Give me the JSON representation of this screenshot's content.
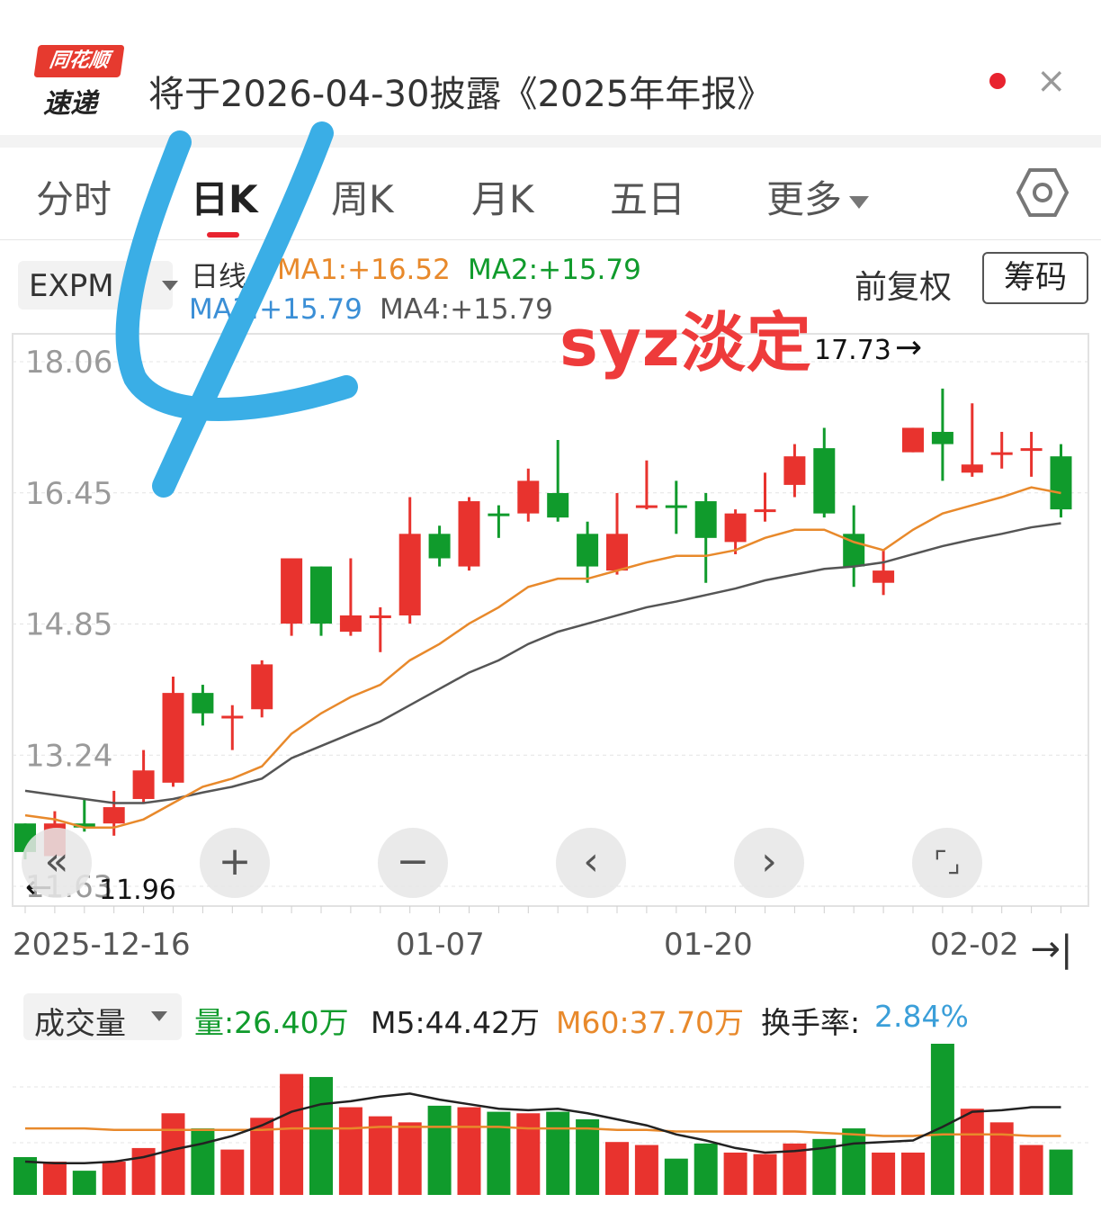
{
  "banner": {
    "logo_top": "同花顺",
    "logo_bottom": "速递",
    "title": "将于2026-04-30披露《2025年年报》",
    "close_glyph": "×"
  },
  "tabs": [
    {
      "label": "分时"
    },
    {
      "label": "日K"
    },
    {
      "label": "周K"
    },
    {
      "label": "月K"
    },
    {
      "label": "五日"
    },
    {
      "label": "更多"
    }
  ],
  "indicator": {
    "selected": "EXPM",
    "line_label": "日线",
    "ma1": "MA1:+16.52",
    "ma2": "MA2:+15.79",
    "ma3": "MA3:+15.79",
    "ma4": "MA4:+15.79",
    "fuquan": "前复权",
    "chouma": "筹码"
  },
  "colors": {
    "up": "#e8332e",
    "down": "#109b2c",
    "ma1": "#e8892b",
    "ma2": "#555555",
    "ma3": "#3b8fd6",
    "turnover": "#3b9fd9",
    "watermark": "#ee3b3b",
    "scribble": "#3aaee6"
  },
  "annotations": {
    "high_label": "17.73",
    "high_arrow": "→",
    "low_label": "11.96",
    "low_arrow": "←",
    "watermark": "syz淡定"
  },
  "controls": [
    {
      "name": "rewind-button",
      "glyph": "«"
    },
    {
      "name": "zoom-in-button",
      "glyph": "+"
    },
    {
      "name": "zoom-out-button",
      "glyph": "−"
    },
    {
      "name": "prev-button",
      "glyph": "‹"
    },
    {
      "name": "next-button",
      "glyph": "›"
    },
    {
      "name": "fullscreen-button",
      "glyph": "⌜⌟"
    }
  ],
  "x_dates": [
    "2025-12-16",
    "01-07",
    "01-20",
    "02-02"
  ],
  "end_glyph": "→|",
  "volume": {
    "selected": "成交量",
    "vol": "量:26.40万",
    "m5": "M5:44.42万",
    "m60": "M60:37.70万",
    "turnover_label": "换手率:",
    "turnover_value": "2.84%"
  },
  "chart_data": {
    "type": "candlestick",
    "y_ticks": [
      "18.06",
      "16.45",
      "14.85",
      "13.24",
      "11.63"
    ],
    "ylim": [
      11.63,
      18.06
    ],
    "candles": [
      {
        "o": 12.05,
        "c": 12.4,
        "h": 12.4,
        "l": 11.96,
        "up": false
      },
      {
        "o": 12.0,
        "c": 12.4,
        "h": 12.55,
        "l": 11.96,
        "up": true
      },
      {
        "o": 12.4,
        "c": 12.35,
        "h": 12.7,
        "l": 12.3,
        "up": false
      },
      {
        "o": 12.4,
        "c": 12.6,
        "h": 12.8,
        "l": 12.25,
        "up": true
      },
      {
        "o": 12.7,
        "c": 13.05,
        "h": 13.3,
        "l": 12.65,
        "up": true
      },
      {
        "o": 12.9,
        "c": 14.0,
        "h": 14.2,
        "l": 12.85,
        "up": true
      },
      {
        "o": 14.0,
        "c": 13.75,
        "h": 14.1,
        "l": 13.6,
        "up": false
      },
      {
        "o": 13.7,
        "c": 13.72,
        "h": 13.85,
        "l": 13.3,
        "up": true
      },
      {
        "o": 13.8,
        "c": 14.35,
        "h": 14.4,
        "l": 13.7,
        "up": true
      },
      {
        "o": 14.85,
        "c": 15.65,
        "h": 15.65,
        "l": 14.7,
        "up": true
      },
      {
        "o": 15.55,
        "c": 14.85,
        "h": 15.55,
        "l": 14.7,
        "up": false
      },
      {
        "o": 14.75,
        "c": 14.95,
        "h": 15.65,
        "l": 14.7,
        "up": true
      },
      {
        "o": 14.95,
        "c": 14.95,
        "h": 15.05,
        "l": 14.5,
        "up": true
      },
      {
        "o": 14.95,
        "c": 15.95,
        "h": 16.4,
        "l": 14.85,
        "up": true
      },
      {
        "o": 15.95,
        "c": 15.65,
        "h": 16.05,
        "l": 15.55,
        "up": false
      },
      {
        "o": 15.55,
        "c": 16.35,
        "h": 16.4,
        "l": 15.5,
        "up": true
      },
      {
        "o": 16.2,
        "c": 16.2,
        "h": 16.3,
        "l": 15.9,
        "up": false
      },
      {
        "o": 16.2,
        "c": 16.6,
        "h": 16.75,
        "l": 16.1,
        "up": true
      },
      {
        "o": 16.45,
        "c": 16.15,
        "h": 17.1,
        "l": 16.1,
        "up": false
      },
      {
        "o": 15.95,
        "c": 15.55,
        "h": 16.1,
        "l": 15.35,
        "up": false
      },
      {
        "o": 15.5,
        "c": 15.95,
        "h": 16.45,
        "l": 15.45,
        "up": true
      },
      {
        "o": 16.3,
        "c": 16.3,
        "h": 16.85,
        "l": 16.25,
        "up": true
      },
      {
        "o": 16.3,
        "c": 16.3,
        "h": 16.6,
        "l": 15.95,
        "up": false
      },
      {
        "o": 16.35,
        "c": 15.9,
        "h": 16.45,
        "l": 15.35,
        "up": false
      },
      {
        "o": 15.85,
        "c": 16.2,
        "h": 16.25,
        "l": 15.7,
        "up": true
      },
      {
        "o": 16.25,
        "c": 16.25,
        "h": 16.7,
        "l": 16.1,
        "up": true
      },
      {
        "o": 16.55,
        "c": 16.9,
        "h": 17.05,
        "l": 16.4,
        "up": true
      },
      {
        "o": 17.0,
        "c": 16.2,
        "h": 17.25,
        "l": 16.15,
        "up": false
      },
      {
        "o": 15.95,
        "c": 15.55,
        "h": 16.3,
        "l": 15.3,
        "up": false
      },
      {
        "o": 15.35,
        "c": 15.5,
        "h": 15.75,
        "l": 15.2,
        "up": true
      },
      {
        "o": 16.95,
        "c": 17.25,
        "h": 17.25,
        "l": 16.95,
        "up": true
      },
      {
        "o": 17.2,
        "c": 17.05,
        "h": 17.73,
        "l": 16.6,
        "up": false
      },
      {
        "o": 16.7,
        "c": 16.8,
        "h": 17.55,
        "l": 16.65,
        "up": true
      },
      {
        "o": 16.95,
        "c": 16.95,
        "h": 17.2,
        "l": 16.75,
        "up": true
      },
      {
        "o": 17.0,
        "c": 17.0,
        "h": 17.2,
        "l": 16.65,
        "up": true
      },
      {
        "o": 16.9,
        "c": 16.25,
        "h": 17.05,
        "l": 16.15,
        "up": false
      }
    ],
    "ma1": [
      12.5,
      12.45,
      12.35,
      12.35,
      12.45,
      12.65,
      12.85,
      12.95,
      13.1,
      13.5,
      13.75,
      13.95,
      14.1,
      14.4,
      14.6,
      14.85,
      15.05,
      15.3,
      15.4,
      15.4,
      15.5,
      15.6,
      15.68,
      15.68,
      15.75,
      15.9,
      16.0,
      16.0,
      15.85,
      15.75,
      16.0,
      16.2,
      16.3,
      16.4,
      16.52,
      16.45
    ],
    "ma2": [
      12.8,
      12.75,
      12.7,
      12.65,
      12.65,
      12.7,
      12.78,
      12.85,
      12.95,
      13.2,
      13.35,
      13.5,
      13.65,
      13.85,
      14.05,
      14.25,
      14.4,
      14.6,
      14.75,
      14.85,
      14.95,
      15.05,
      15.12,
      15.2,
      15.28,
      15.38,
      15.45,
      15.52,
      15.55,
      15.6,
      15.7,
      15.8,
      15.88,
      15.95,
      16.03,
      16.08
    ],
    "volume_max": 100,
    "volumes": [
      25,
      22,
      16,
      22,
      31,
      54,
      44,
      30,
      51,
      80,
      78,
      58,
      52,
      48,
      59,
      58,
      55,
      54,
      55,
      50,
      35,
      33,
      24,
      34,
      28,
      27,
      34,
      37,
      44,
      28,
      28,
      100,
      57,
      48,
      33,
      30
    ],
    "vol_m5": [
      22,
      21,
      21,
      22,
      25,
      30,
      34,
      39,
      46,
      55,
      60,
      62,
      65,
      67,
      63,
      60,
      57,
      56,
      57,
      54,
      50,
      46,
      40,
      36,
      31,
      28,
      29,
      31,
      34,
      35,
      36,
      45,
      55,
      56,
      58,
      58
    ],
    "vol_m60": [
      44,
      44,
      44,
      43,
      43,
      43,
      43,
      43,
      43,
      44,
      44,
      44,
      45,
      45,
      45,
      45,
      45,
      44,
      44,
      44,
      43,
      43,
      42,
      42,
      42,
      42,
      42,
      41,
      40,
      39,
      39,
      40,
      40,
      40,
      39,
      39
    ]
  }
}
